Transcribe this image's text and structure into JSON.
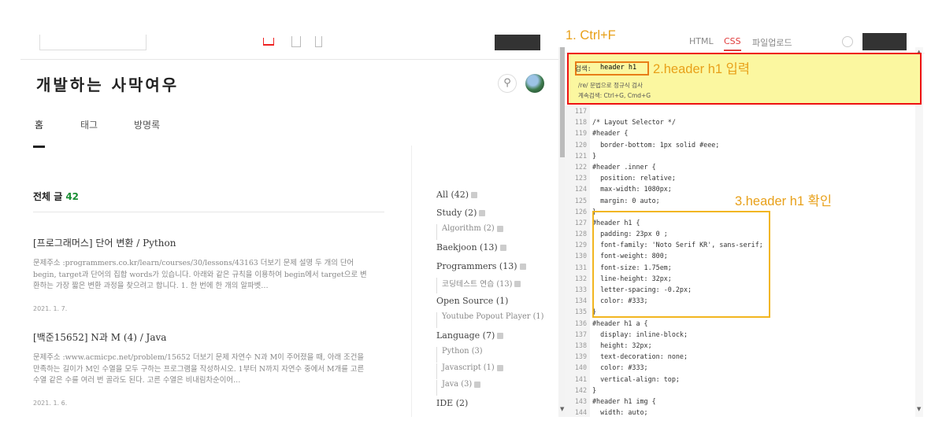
{
  "blog": {
    "title": "개발하는 사막여우",
    "nav": {
      "home": "홈",
      "tag": "태그",
      "guestbook": "방명록"
    },
    "list_label": "전체 글",
    "list_count": "42",
    "posts": [
      {
        "title": "[프로그래머스] 단어 변환 / Python",
        "body": "문제주소 :programmers.co.kr/learn/courses/30/lessons/43163 더보기 문제 설명 두 개의 단어 begin, target과 단어의 집합 words가 있습니다. 아래와 같은 규칙을 이용하여 begin에서 target으로 변환하는 가장 짧은 변환 과정을 찾으려고 합니다. 1. 한 번에 한 개의 알파벳…",
        "date": "2021. 1. 7."
      },
      {
        "title": "[백준15652] N과 M (4) / Java",
        "body": "문제주소 :www.acmicpc.net/problem/15652 더보기 문제 자연수 N과 M이 주어졌을 때, 아래 조건을 만족하는 길이가 M인 수열을 모두 구하는 프로그램을 작성하시오. 1부터 N까지 자연수 중에서 M개를 고른 수열 같은 수를 여러 번 골라도 된다. 고른 수열은 비내림차순이어…",
        "date": "2021. 1. 6."
      }
    ],
    "categories": [
      {
        "label": "All (42)",
        "sub": false,
        "badge": true
      },
      {
        "label": "Study (2)",
        "sub": false,
        "badge": true
      },
      {
        "label": "Algorithm (2)",
        "sub": true,
        "badge": true
      },
      {
        "label": "Baekjoon (13)",
        "sub": false,
        "badge": true
      },
      {
        "label": "Programmers (13)",
        "sub": false,
        "badge": true
      },
      {
        "label": "코딩테스트 연습 (13)",
        "sub": true,
        "badge": true
      },
      {
        "label": "Open Source (1)",
        "sub": false,
        "badge": false
      },
      {
        "label": "Youtube Popout Player (1)",
        "sub": true,
        "badge": false
      },
      {
        "label": "Language (7)",
        "sub": false,
        "badge": true
      },
      {
        "label": "Python (3)",
        "sub": true,
        "badge": false
      },
      {
        "label": "Javascript (1)",
        "sub": true,
        "badge": true
      },
      {
        "label": "Java (3)",
        "sub": true,
        "badge": true
      },
      {
        "label": "IDE (2)",
        "sub": false,
        "badge": false
      }
    ]
  },
  "editor": {
    "tabs": {
      "html": "HTML",
      "css": "CSS",
      "files": "파일업로드"
    },
    "search": {
      "label": "검색:",
      "query": "header h1",
      "hint1": "/re/ 문법으로 정규식 검사",
      "hint2": "계속검색: Ctrl+G, Cmd+G"
    },
    "lines": [
      {
        "n": "117",
        "t": ""
      },
      {
        "n": "118",
        "t": "/* Layout Selector */",
        "k": "com"
      },
      {
        "n": "119",
        "t": "#header {",
        "k": "sel"
      },
      {
        "n": "120",
        "t": "  border-bottom: 1px solid #eee;"
      },
      {
        "n": "121",
        "t": "}"
      },
      {
        "n": "122",
        "t": "#header .inner {",
        "k": "sel"
      },
      {
        "n": "123",
        "t": "  position: relative;"
      },
      {
        "n": "124",
        "t": "  max-width: 1080px;"
      },
      {
        "n": "125",
        "t": "  margin: 0 auto;"
      },
      {
        "n": "126",
        "t": "}"
      },
      {
        "n": "127",
        "t": "#header h1 {",
        "k": "sel"
      },
      {
        "n": "128",
        "t": "  padding: 23px 0 ;"
      },
      {
        "n": "129",
        "t": "  font-family: 'Noto Serif KR', sans-serif;"
      },
      {
        "n": "130",
        "t": "  font-weight: 800;"
      },
      {
        "n": "131",
        "t": "  font-size: 1.75em;"
      },
      {
        "n": "132",
        "t": "  line-height: 32px;"
      },
      {
        "n": "133",
        "t": "  letter-spacing: -0.2px;"
      },
      {
        "n": "134",
        "t": "  color: #333;"
      },
      {
        "n": "135",
        "t": "}"
      },
      {
        "n": "136",
        "t": "#header h1 a {",
        "k": "sel"
      },
      {
        "n": "137",
        "t": "  display: inline-block;"
      },
      {
        "n": "138",
        "t": "  height: 32px;"
      },
      {
        "n": "139",
        "t": "  text-decoration: none;"
      },
      {
        "n": "140",
        "t": "  color: #333;"
      },
      {
        "n": "141",
        "t": "  vertical-align: top;"
      },
      {
        "n": "142",
        "t": "}"
      },
      {
        "n": "143",
        "t": "#header h1 img {",
        "k": "sel"
      },
      {
        "n": "144",
        "t": "  width: auto;"
      }
    ]
  },
  "annotations": {
    "step1": "1. Ctrl+F",
    "step2": "2.header h1 입력",
    "step3": "3.header h1 확인"
  },
  "colors": {
    "annotation": "#e8a019",
    "search_border": "#ee1111",
    "search_bg": "#fbf7a0",
    "highlight_box": "#f2b620",
    "count_green": "#1a8f35"
  }
}
